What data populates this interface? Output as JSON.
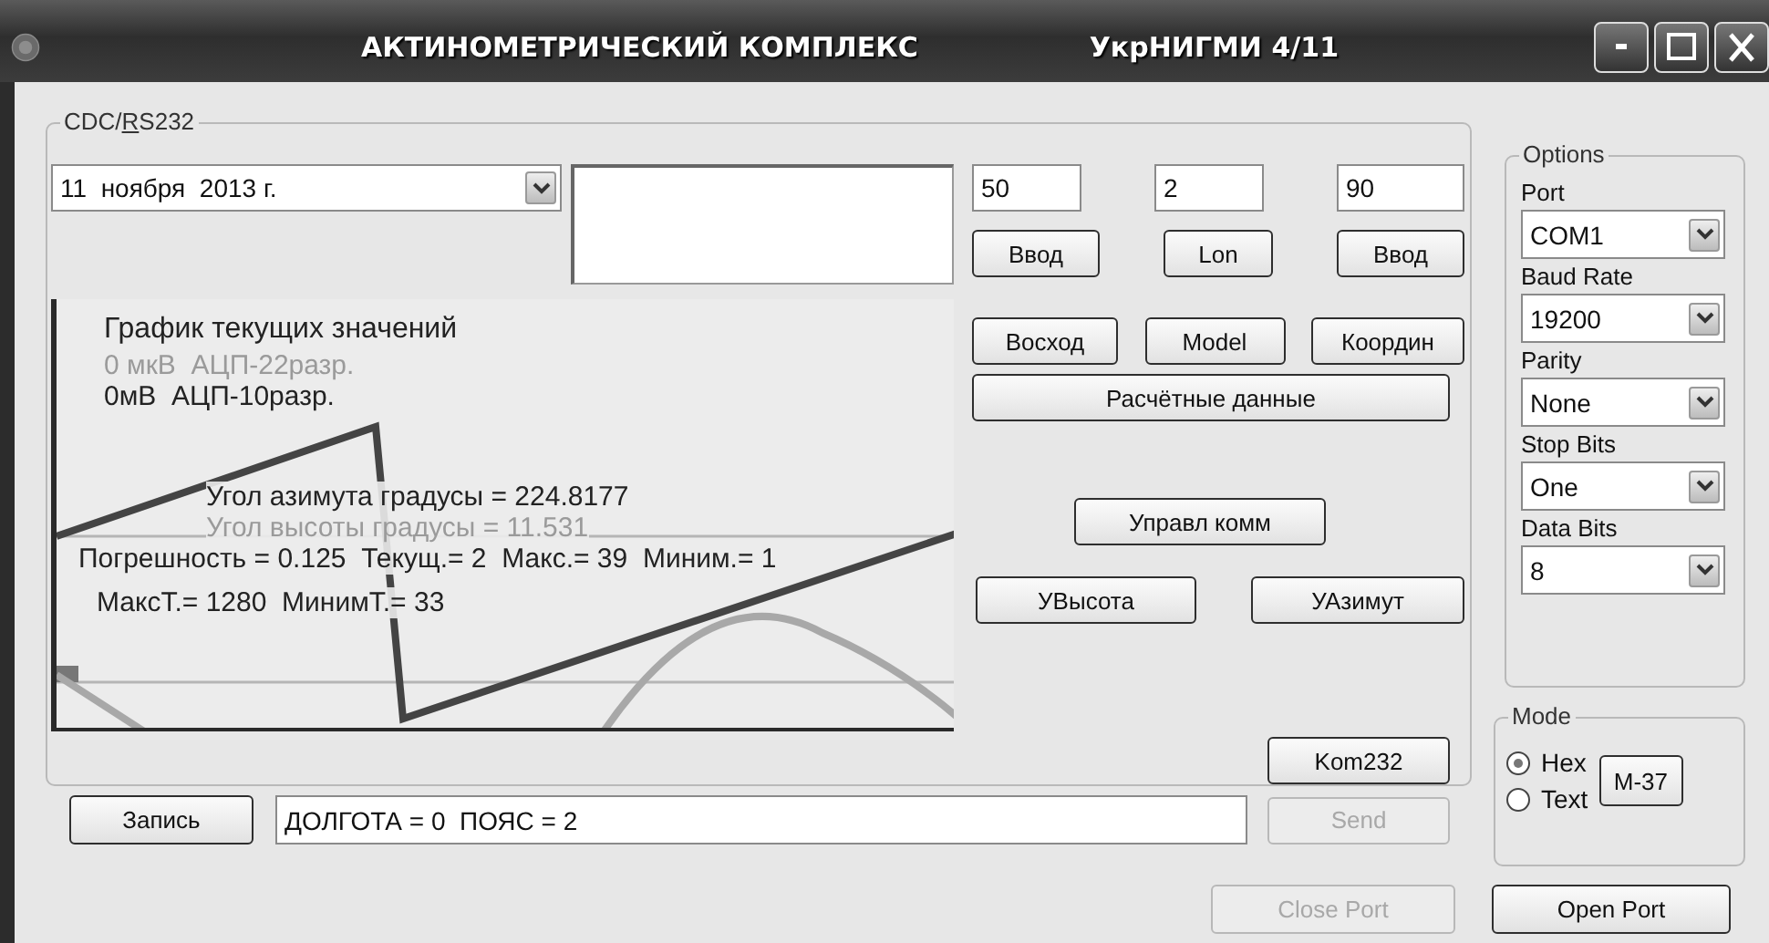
{
  "window": {
    "title": "АКТИНОМЕТРИЧЕСКИЙ КОМПЛЕКС",
    "subtitle": "УкрНИГМИ 4/11"
  },
  "connection": {
    "title": "CDC/RS232",
    "date": "11  ноября  2013 г.",
    "fields": [
      "50",
      "2",
      "90"
    ],
    "button_rows": [
      [
        {
          "label": "Ввод",
          "disabled": false
        },
        {
          "label": "Lon",
          "disabled": false
        },
        {
          "label": "Ввод",
          "disabled": false
        }
      ],
      [
        {
          "label": "Восход",
          "disabled": false
        },
        {
          "label": "Model",
          "disabled": false
        },
        {
          "label": "Координ",
          "disabled": false
        }
      ],
      [
        {
          "label": "Расчётные данные",
          "disabled": false
        }
      ],
      [
        {
          "label": "Управл комм",
          "disabled": false
        }
      ],
      [
        {
          "label": "УВысота",
          "disabled": false
        },
        {
          "label": "УАзимут",
          "disabled": false
        }
      ],
      [
        {
          "label": "Kom232",
          "disabled": false
        }
      ]
    ],
    "graph": {
      "title": "График текущих значений",
      "lines": [
        {
          "text": "0 мкВ  АЦП-22разр.",
          "faint": true
        },
        {
          "text": "0мВ  АЦП-10разр.",
          "faint": false
        },
        {
          "text": "Угол азимута градусы = 224.8177",
          "faint": false
        },
        {
          "text": "Угол высоты градусы = 11.531",
          "faint": true
        },
        {
          "text": "Погрешность = 0.125  Текущ.= 2  Макс.= 39  Миним.= 1",
          "faint": false
        },
        {
          "text": "МаксТ.= 1280  МинимТ.= 33",
          "faint": false
        }
      ]
    },
    "record_button": {
      "label": "Запись",
      "disabled": false
    },
    "message": {
      "value": "ДОЛГОТА = 0  ПОЯС = 2"
    },
    "send_button": {
      "label": "Send",
      "disabled": true
    }
  },
  "options": {
    "title": "Options",
    "settings": [
      {
        "label": "Port",
        "value": "COM1"
      },
      {
        "label": "Baud Rate",
        "value": "19200"
      },
      {
        "label": "Parity",
        "value": "None"
      },
      {
        "label": "Stop Bits",
        "value": "One"
      },
      {
        "label": "Data Bits",
        "value": "8"
      }
    ]
  },
  "mode": {
    "title": "Mode",
    "radios": [
      {
        "label": "Hex",
        "selected": true
      },
      {
        "label": "Text",
        "selected": false
      }
    ],
    "button": {
      "label": "M-37",
      "disabled": false
    }
  },
  "port_buttons": [
    {
      "label": "Close Port",
      "disabled": true
    },
    {
      "label": "Open Port",
      "disabled": false
    }
  ]
}
